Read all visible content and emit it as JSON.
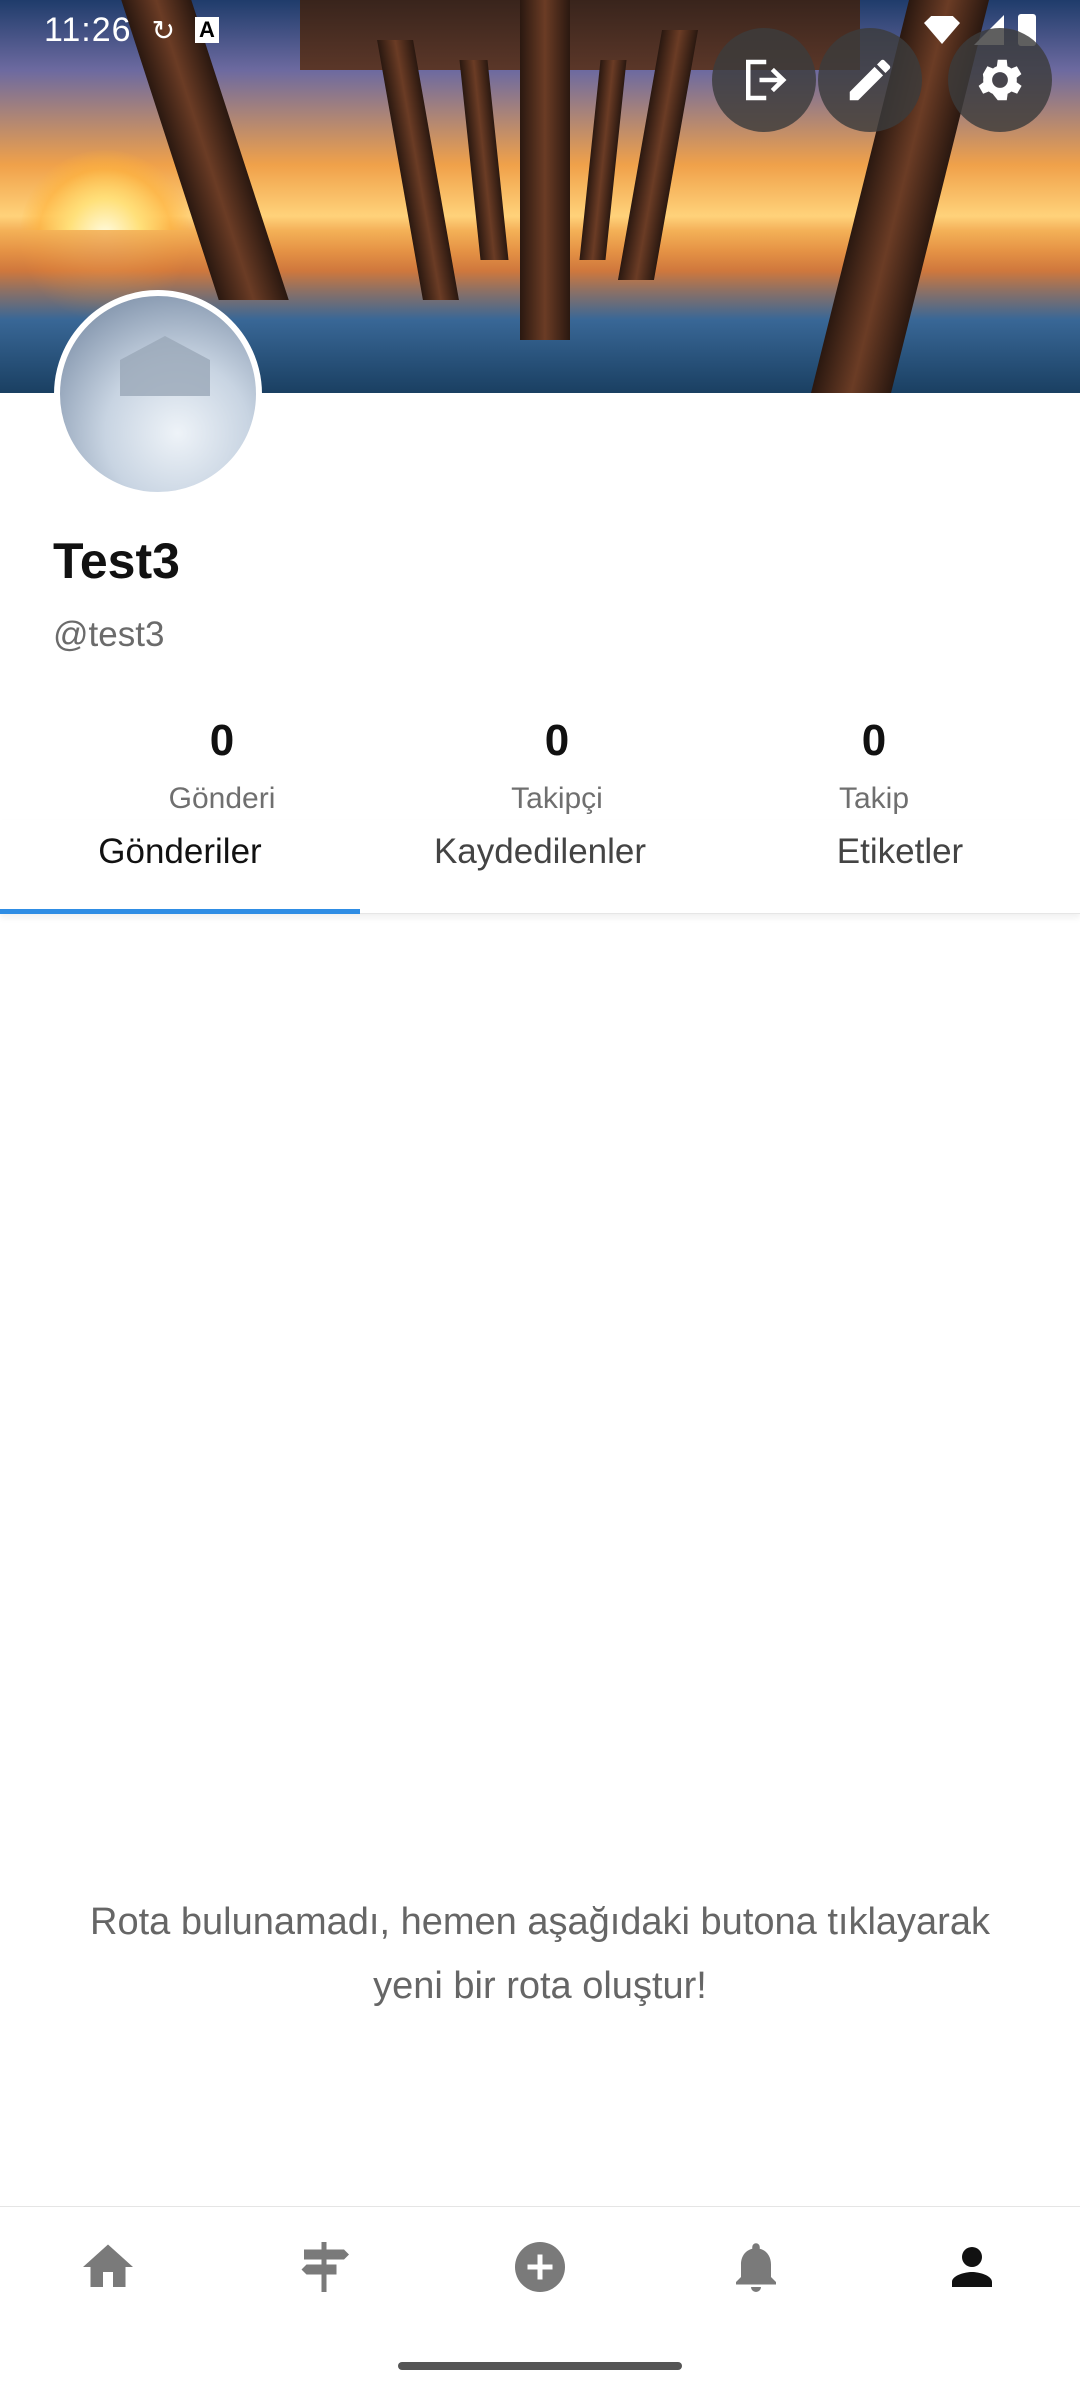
{
  "status_bar": {
    "time": "11:26"
  },
  "header": {
    "buttons": [
      {
        "name": "logout",
        "icon": "logout-icon"
      },
      {
        "name": "edit",
        "icon": "pencil-icon"
      },
      {
        "name": "settings",
        "icon": "gear-icon"
      }
    ]
  },
  "profile": {
    "display_name": "Test3",
    "handle": "@test3"
  },
  "stats": [
    {
      "value": "0",
      "label": "Gönderi"
    },
    {
      "value": "0",
      "label": "Takipçi"
    },
    {
      "value": "0",
      "label": "Takip"
    }
  ],
  "tabs": [
    {
      "label": "Gönderiler",
      "active": true
    },
    {
      "label": "Kaydedilenler",
      "active": false
    },
    {
      "label": "Etiketler",
      "active": false
    }
  ],
  "empty_message": "Rota bulunamadı, hemen aşağıdaki butona tıklayarak yeni bir rota oluştur!",
  "bottom_nav": [
    {
      "name": "home",
      "icon": "home-icon",
      "active": false
    },
    {
      "name": "routes",
      "icon": "signpost-icon",
      "active": false
    },
    {
      "name": "create",
      "icon": "plus-circle-icon",
      "active": false
    },
    {
      "name": "notifications",
      "icon": "bell-icon",
      "active": false
    },
    {
      "name": "profile",
      "icon": "person-icon",
      "active": true
    }
  ],
  "colors": {
    "accent": "#2f8de4",
    "text_primary": "#111111",
    "text_secondary": "#6b6b6b"
  }
}
